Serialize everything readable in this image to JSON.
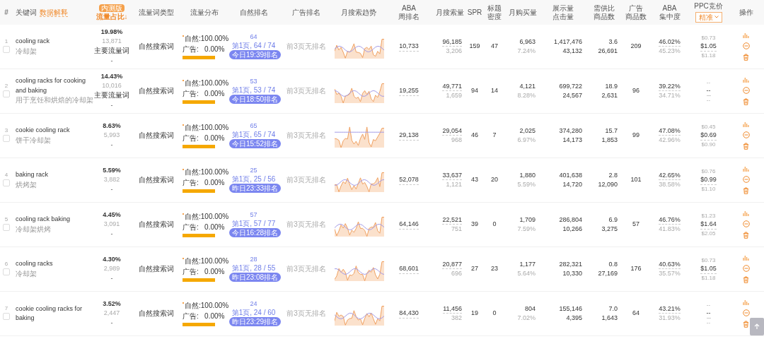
{
  "header": {
    "index": "#",
    "keyword": "关键词",
    "keyword_link": "数据解释",
    "share_badge": "内测版",
    "share": "流量占比↓",
    "type": "流量词类型",
    "distribution": "流量分布",
    "natural_rank": "自然排名",
    "ad_rank": "广告排名",
    "trend": "月搜索趋势",
    "aba": [
      "ABA",
      "周排名"
    ],
    "monthly_search": "月搜索量",
    "spr": "SPR",
    "title_density": [
      "标题",
      "密度"
    ],
    "monthly_buy": "月购买量",
    "impressions": [
      "展示量",
      "点击量"
    ],
    "demand": [
      "需供比",
      "商品数"
    ],
    "ad_products": [
      "广告",
      "商品数"
    ],
    "aba_conc": [
      "ABA",
      "集中度"
    ],
    "ppc": "PPC竞价",
    "ppc_mode": "精准",
    "actions": "操作"
  },
  "rows": [
    {
      "index": "1",
      "keyword": "cooling rack",
      "translation": "冷却架",
      "checked": false,
      "share": "19.98%",
      "share_count": "13,871",
      "share_tag": "主要流量词",
      "share_note": "-",
      "type": "自然搜索词",
      "natural": "自然:100.00%",
      "ad": "广告:   0.00%",
      "level": 1,
      "rank": "64",
      "rank_text": "第1页, 64 / 74",
      "rank_time": "今日19:39排名",
      "ad_rank": "前3页无排名",
      "aba": "10,733",
      "search": "96,185",
      "search_sub": "3,206",
      "spr": "159",
      "density": "47",
      "buy": "6,963",
      "buy_rate": "7.24%",
      "impressions": "1,417,476",
      "clicks": "43,132",
      "demand": "3.6",
      "products": "26,691",
      "ad_products": "209",
      "conc": "46.02%",
      "conc_sub": "45.23%",
      "ppc_low": "$0.73",
      "ppc": "$1.05",
      "ppc_high": "$1.18"
    },
    {
      "index": "2",
      "keyword": "cooling racks for cooking and baking",
      "translation": "用于烹饪和烘焙的冷却架",
      "checked": false,
      "share": "14.43%",
      "share_count": "10,016",
      "share_tag": "主要流量词",
      "share_note": "-",
      "type": "自然搜索词",
      "natural": "自然:100.00%",
      "ad": "广告:   0.00%",
      "level": 1,
      "rank": "53",
      "rank_text": "第1页, 53 / 74",
      "rank_time": "今日18:50排名",
      "ad_rank": "前3页无排名",
      "aba": "19,255",
      "search": "49,771",
      "search_sub": "1,659",
      "spr": "94",
      "density": "14",
      "buy": "4,121",
      "buy_rate": "8.28%",
      "impressions": "699,722",
      "clicks": "24,567",
      "demand": "18.9",
      "products": "2,631",
      "ad_products": "96",
      "conc": "39.22%",
      "conc_sub": "34.71%",
      "ppc_low": "--",
      "ppc": "--",
      "ppc_high": "--"
    },
    {
      "index": "3",
      "keyword": "cookie cooling rack",
      "translation": "饼干冷却架",
      "checked": false,
      "share": "8.63%",
      "share_count": "5,993",
      "share_note": "-",
      "type": "自然搜索词",
      "natural": "自然:100.00%",
      "ad": "广告:   0.00%",
      "level": 1,
      "rank": "65",
      "rank_text": "第1页, 65 / 74",
      "rank_time": "今日15:52排名",
      "ad_rank": "前3页无排名",
      "aba": "29,138",
      "search": "29,054",
      "search_sub": "968",
      "spr": "46",
      "density": "7",
      "buy": "2,025",
      "buy_rate": "6.97%",
      "impressions": "374,280",
      "clicks": "14,173",
      "demand": "15.7",
      "products": "1,853",
      "ad_products": "99",
      "conc": "47.08%",
      "conc_sub": "42.96%",
      "ppc_low": "$0.45",
      "ppc": "$0.69",
      "ppc_high": "$0.90"
    },
    {
      "index": "4",
      "keyword": "baking rack",
      "translation": "烘烤架",
      "checked": false,
      "share": "5.59%",
      "share_count": "3,882",
      "share_note": "-",
      "type": "自然搜索词",
      "natural": "自然:100.00%",
      "ad": "广告:   0.00%",
      "level": 1,
      "rank": "25",
      "rank_text": "第1页, 25 / 56",
      "rank_time": "昨日23:33排名",
      "ad_rank": "前3页无排名",
      "aba": "52,078",
      "search": "33,637",
      "search_sub": "1,121",
      "spr": "43",
      "density": "20",
      "buy": "1,880",
      "buy_rate": "5.59%",
      "impressions": "401,638",
      "clicks": "14,720",
      "demand": "2.8",
      "products": "12,090",
      "ad_products": "101",
      "conc": "42.65%",
      "conc_sub": "38.58%",
      "ppc_low": "$0.76",
      "ppc": "$0.99",
      "ppc_high": "$1.10"
    },
    {
      "index": "5",
      "keyword": "cooling rack baking",
      "translation": "冷却架烘烤",
      "checked": false,
      "share": "4.45%",
      "share_count": "3,091",
      "share_note": "-",
      "type": "自然搜索词",
      "natural": "自然:100.00%",
      "ad": "广告:   0.00%",
      "level": 1,
      "rank": "57",
      "rank_text": "第1页, 57 / 77",
      "rank_time": "今日16:28排名",
      "ad_rank": "前3页无排名",
      "aba": "64,146",
      "search": "22,521",
      "search_sub": "751",
      "spr": "39",
      "density": "0",
      "buy": "1,709",
      "buy_rate": "7.59%",
      "impressions": "286,804",
      "clicks": "10,266",
      "demand": "6.9",
      "products": "3,275",
      "ad_products": "57",
      "conc": "46.76%",
      "conc_sub": "41.83%",
      "ppc_low": "$1.23",
      "ppc": "$1.64",
      "ppc_high": "$2.05"
    },
    {
      "index": "6",
      "keyword": "cooling racks",
      "translation": "冷却架",
      "checked": false,
      "share": "4.30%",
      "share_count": "2,989",
      "share_note": "-",
      "type": "自然搜索词",
      "natural": "自然:100.00%",
      "ad": "广告:   0.00%",
      "level": 1,
      "rank": "28",
      "rank_text": "第1页, 28 / 55",
      "rank_time": "昨日23:08排名",
      "ad_rank": "前3页无排名",
      "aba": "68,601",
      "search": "20,877",
      "search_sub": "696",
      "spr": "27",
      "density": "23",
      "buy": "1,177",
      "buy_rate": "5.64%",
      "impressions": "282,321",
      "clicks": "10,330",
      "demand": "0.8",
      "products": "27,169",
      "ad_products": "176",
      "conc": "40.63%",
      "conc_sub": "35.57%",
      "ppc_low": "$0.73",
      "ppc": "$1.05",
      "ppc_high": "$1.18"
    },
    {
      "index": "7",
      "keyword": "cookie cooling racks for baking",
      "checked": false,
      "share": "3.52%",
      "share_count": "2,447",
      "share_note": "-",
      "type": "自然搜索词",
      "natural": "自然:100.00%",
      "ad": "广告:   0.00%",
      "level": 1,
      "rank": "24",
      "rank_text": "第1页, 24 / 60",
      "rank_time": "昨日23:29排名",
      "ad_rank": "前3页无排名",
      "aba": "84,430",
      "search": "11,456",
      "search_sub": "382",
      "spr": "19",
      "density": "0",
      "buy": "804",
      "buy_rate": "7.02%",
      "impressions": "155,146",
      "clicks": "4,395",
      "demand": "7.0",
      "products": "1,643",
      "ad_products": "64",
      "conc": "43.21%",
      "conc_sub": "31.93%",
      "ppc_low": "--",
      "ppc": "--",
      "ppc_high": "--"
    }
  ]
}
